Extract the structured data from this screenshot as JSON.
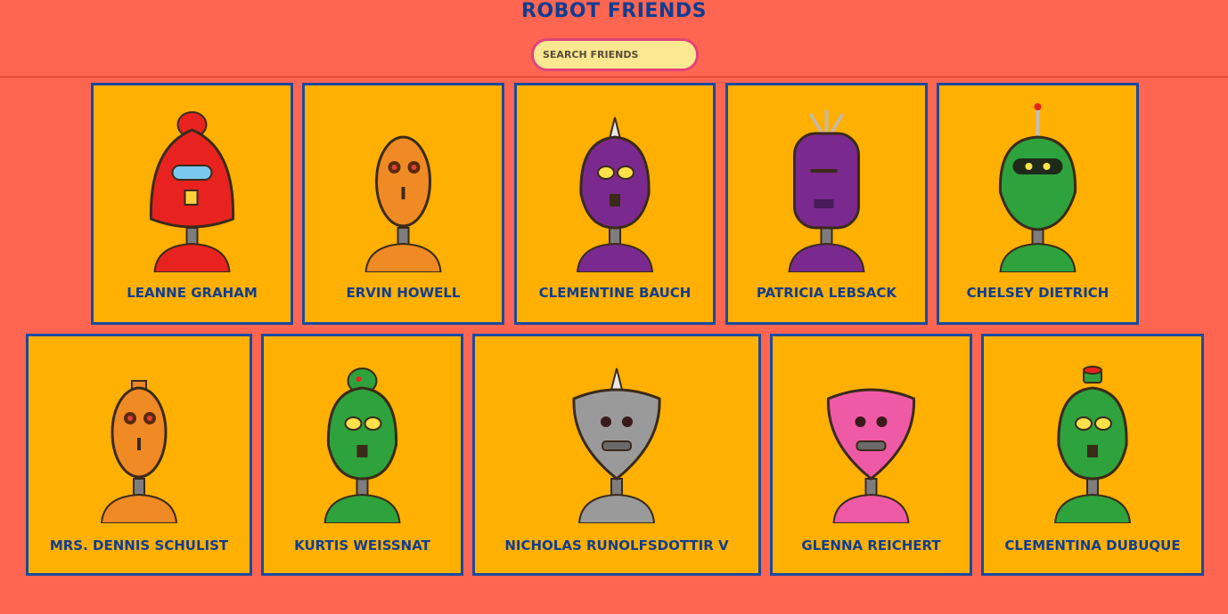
{
  "header": {
    "title": "ROBOT FRIENDS",
    "search_placeholder": "SEARCH FRIENDS",
    "search_value": ""
  },
  "robots": [
    {
      "name": "LEANNE GRAHAM",
      "color": "#e8231f",
      "shape": "tall",
      "accent": "red-dish"
    },
    {
      "name": "ERVIN HOWELL",
      "color": "#f08a24",
      "shape": "oval",
      "accent": "none"
    },
    {
      "name": "CLEMENTINE BAUCH",
      "color": "#7a2a8e",
      "shape": "egg",
      "accent": "horn"
    },
    {
      "name": "PATRICIA LEBSACK",
      "color": "#7a2a8e",
      "shape": "box",
      "accent": "wires"
    },
    {
      "name": "CHELSEY DIETRICH",
      "color": "#2ea23c",
      "shape": "helmet",
      "accent": "antenna"
    },
    {
      "name": "MRS. DENNIS SCHULIST",
      "color": "#f08a24",
      "shape": "oval",
      "accent": "box"
    },
    {
      "name": "KURTIS WEISSNAT",
      "color": "#2ea23c",
      "shape": "egg",
      "accent": "dome"
    },
    {
      "name": "NICHOLAS RUNOLFSDOTTIR V",
      "color": "#9a9a9a",
      "shape": "shield",
      "accent": "horn"
    },
    {
      "name": "GLENNA REICHERT",
      "color": "#ef5aa6",
      "shape": "shield",
      "accent": "none"
    },
    {
      "name": "CLEMENTINA DUBUQUE",
      "color": "#2ea23c",
      "shape": "egg",
      "accent": "hat"
    }
  ]
}
